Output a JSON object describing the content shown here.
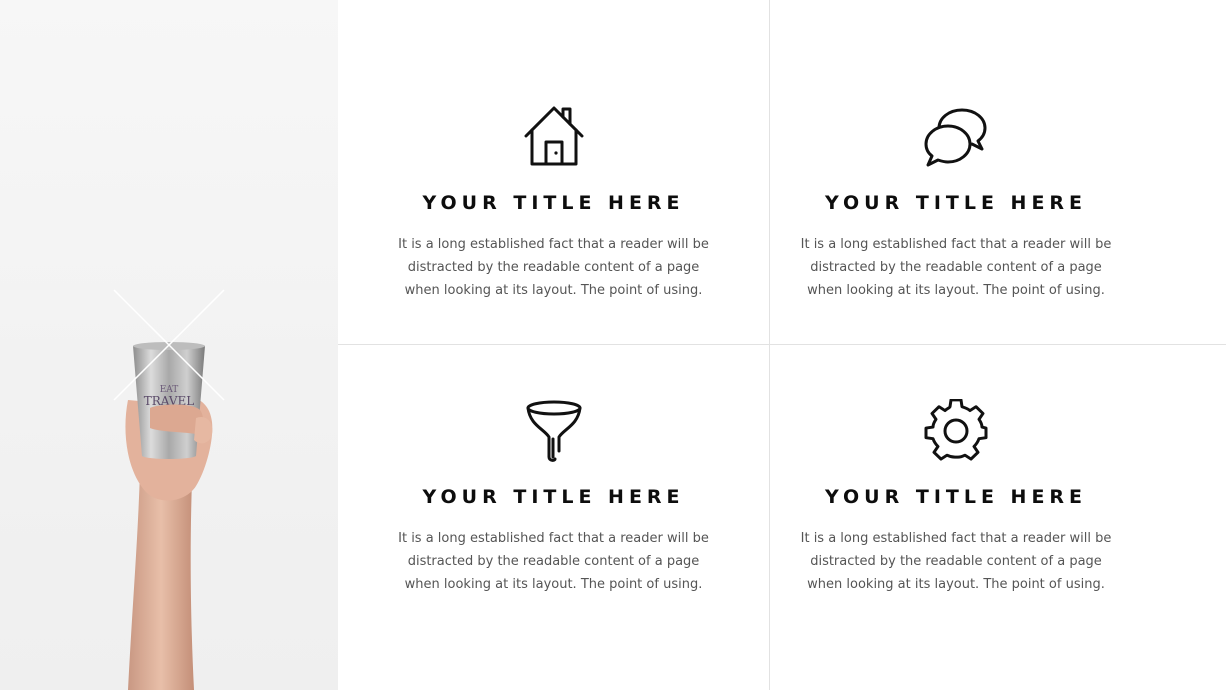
{
  "features": [
    {
      "icon": "house-icon",
      "title": "YOUR TITLE HERE",
      "description": "It is a long established fact that a reader will be distracted by the readable content of a page when looking at its layout. The point of using."
    },
    {
      "icon": "chat-bubbles-icon",
      "title": "YOUR TITLE HERE",
      "description": "It is a long established fact that a reader will be distracted by the readable content of a page when looking at its layout. The point of using."
    },
    {
      "icon": "funnel-icon",
      "title": "YOUR TITLE HERE",
      "description": "It is a long established fact that a reader will be distracted by the readable content of a page when looking at its layout. The point of using."
    },
    {
      "icon": "gear-icon",
      "title": "YOUR TITLE HERE",
      "description": "It is a long established fact that a reader will be distracted by the readable content of a page when looking at its layout. The point of using."
    }
  ],
  "photo": {
    "cup_text": "TRAVEL"
  },
  "colors": {
    "title": "#0d0d0d",
    "body_text": "#555555",
    "divider": "#e2e2e2",
    "background": "#ffffff"
  }
}
